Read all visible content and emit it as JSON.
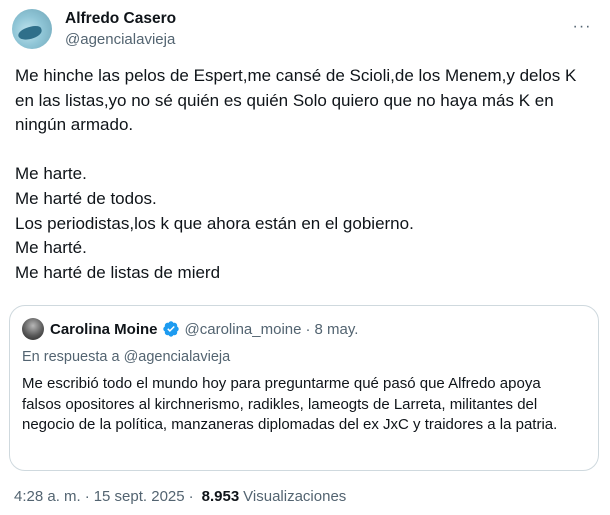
{
  "author": {
    "display_name": "Alfredo Casero",
    "handle": "@agencialavieja"
  },
  "menu": {
    "icon": "more-horizontal-icon",
    "glyph": "···"
  },
  "tweet": {
    "lines": [
      "Me hinche las pelos de Espert,me cansé de Scioli,de los Menem,y delos K en las listas,yo no sé quién es quién Solo quiero que no haya más K en ningún armado.",
      "",
      "Me harte.",
      "Me harté de todos.",
      "Los periodistas,los k que ahora están en el gobierno.",
      "Me harté.",
      "Me harté de listas de mierd"
    ]
  },
  "quote": {
    "display_name": "Carolina Moine",
    "verified_icon": "verified-badge-icon",
    "verified_color": "#1d9bf0",
    "handle": "@carolina_moine",
    "separator": "·",
    "date": "8 may.",
    "reply_to": "En respuesta a @agencialavieja",
    "text": "Me escribió todo el mundo hoy para preguntarme qué pasó que Alfredo apoya falsos opositores al kirchnerismo, radikles, lameogts de Larreta, militantes del negocio de la política, manzaneras diplomadas del ex JxC y traidores a la patria."
  },
  "meta": {
    "time": "4:28 a. m.",
    "separator": "·",
    "date": "15 sept. 2025",
    "views_separator": "·",
    "views_count": "8.953",
    "views_label": "Visualizaciones"
  }
}
